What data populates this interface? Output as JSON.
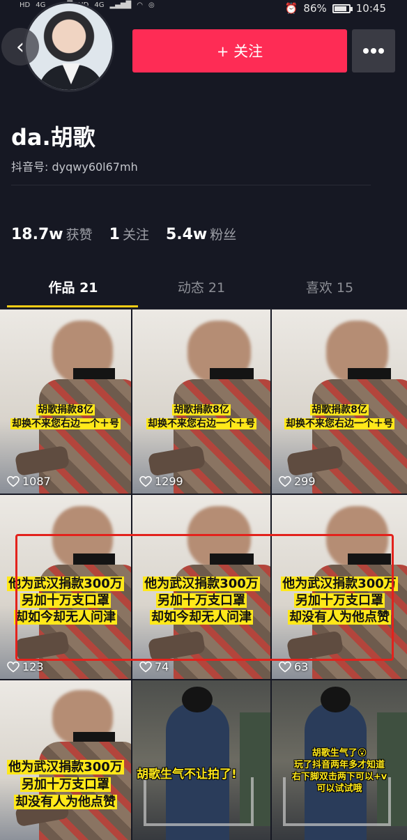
{
  "status_bar": {
    "left": [
      "HD",
      "4G",
      "HD",
      "4G"
    ],
    "battery_percent": "86%",
    "battery_level": 0.86,
    "time": "10:45"
  },
  "header": {
    "back_icon": "chevron-left-icon",
    "follow_label": "+ 关注",
    "more_icon": "more-dots-icon"
  },
  "profile": {
    "username": "da.胡歌",
    "douyin_id": "抖音号: dyqwy60l67mh"
  },
  "stats": [
    {
      "value": "18.7w",
      "label": "获赞"
    },
    {
      "value": "1",
      "label": "关注"
    },
    {
      "value": "5.4w",
      "label": "粉丝"
    }
  ],
  "tabs": [
    {
      "label": "作品 21"
    },
    {
      "label": "动态 21"
    },
    {
      "label": "喜欢 15"
    }
  ],
  "colors": {
    "background": "#161823",
    "accent": "#fe2c55",
    "tab_indicator": "#face15",
    "highlight": "#e3221c"
  },
  "videos": [
    {
      "caption": [
        "胡歌捐款8亿",
        "却换不来您右边一个＋号"
      ],
      "likes": "1087"
    },
    {
      "caption": [
        "胡歌捐款8亿",
        "却换不来您右边一个＋号"
      ],
      "likes": "1299"
    },
    {
      "caption": [
        "胡歌捐款8亿",
        "却换不来您右边一个＋号"
      ],
      "likes": "299"
    },
    {
      "caption": [
        "他为武汉捐款300万",
        "另加十万支口罩",
        "却如今却无人问津"
      ],
      "likes": "123"
    },
    {
      "caption": [
        "他为武汉捐款300万",
        "另加十万支口罩",
        "却如今却无人问津"
      ],
      "likes": "74"
    },
    {
      "caption": [
        "他为武汉捐款300万",
        "另加十万支口罩",
        "却没有人为他点赞"
      ],
      "likes": "63"
    },
    {
      "caption": [
        "他为武汉捐款300万",
        "另加十万支口罩",
        "却没有人为他点赞"
      ],
      "likes": ""
    },
    {
      "caption": [
        "胡歌生气不让拍了!"
      ],
      "likes": ""
    },
    {
      "caption": [
        "胡歌生气了😮",
        "玩了抖音两年多才知道",
        "右下脚双击两下可以+v",
        "可以试试哦"
      ],
      "likes": ""
    }
  ]
}
